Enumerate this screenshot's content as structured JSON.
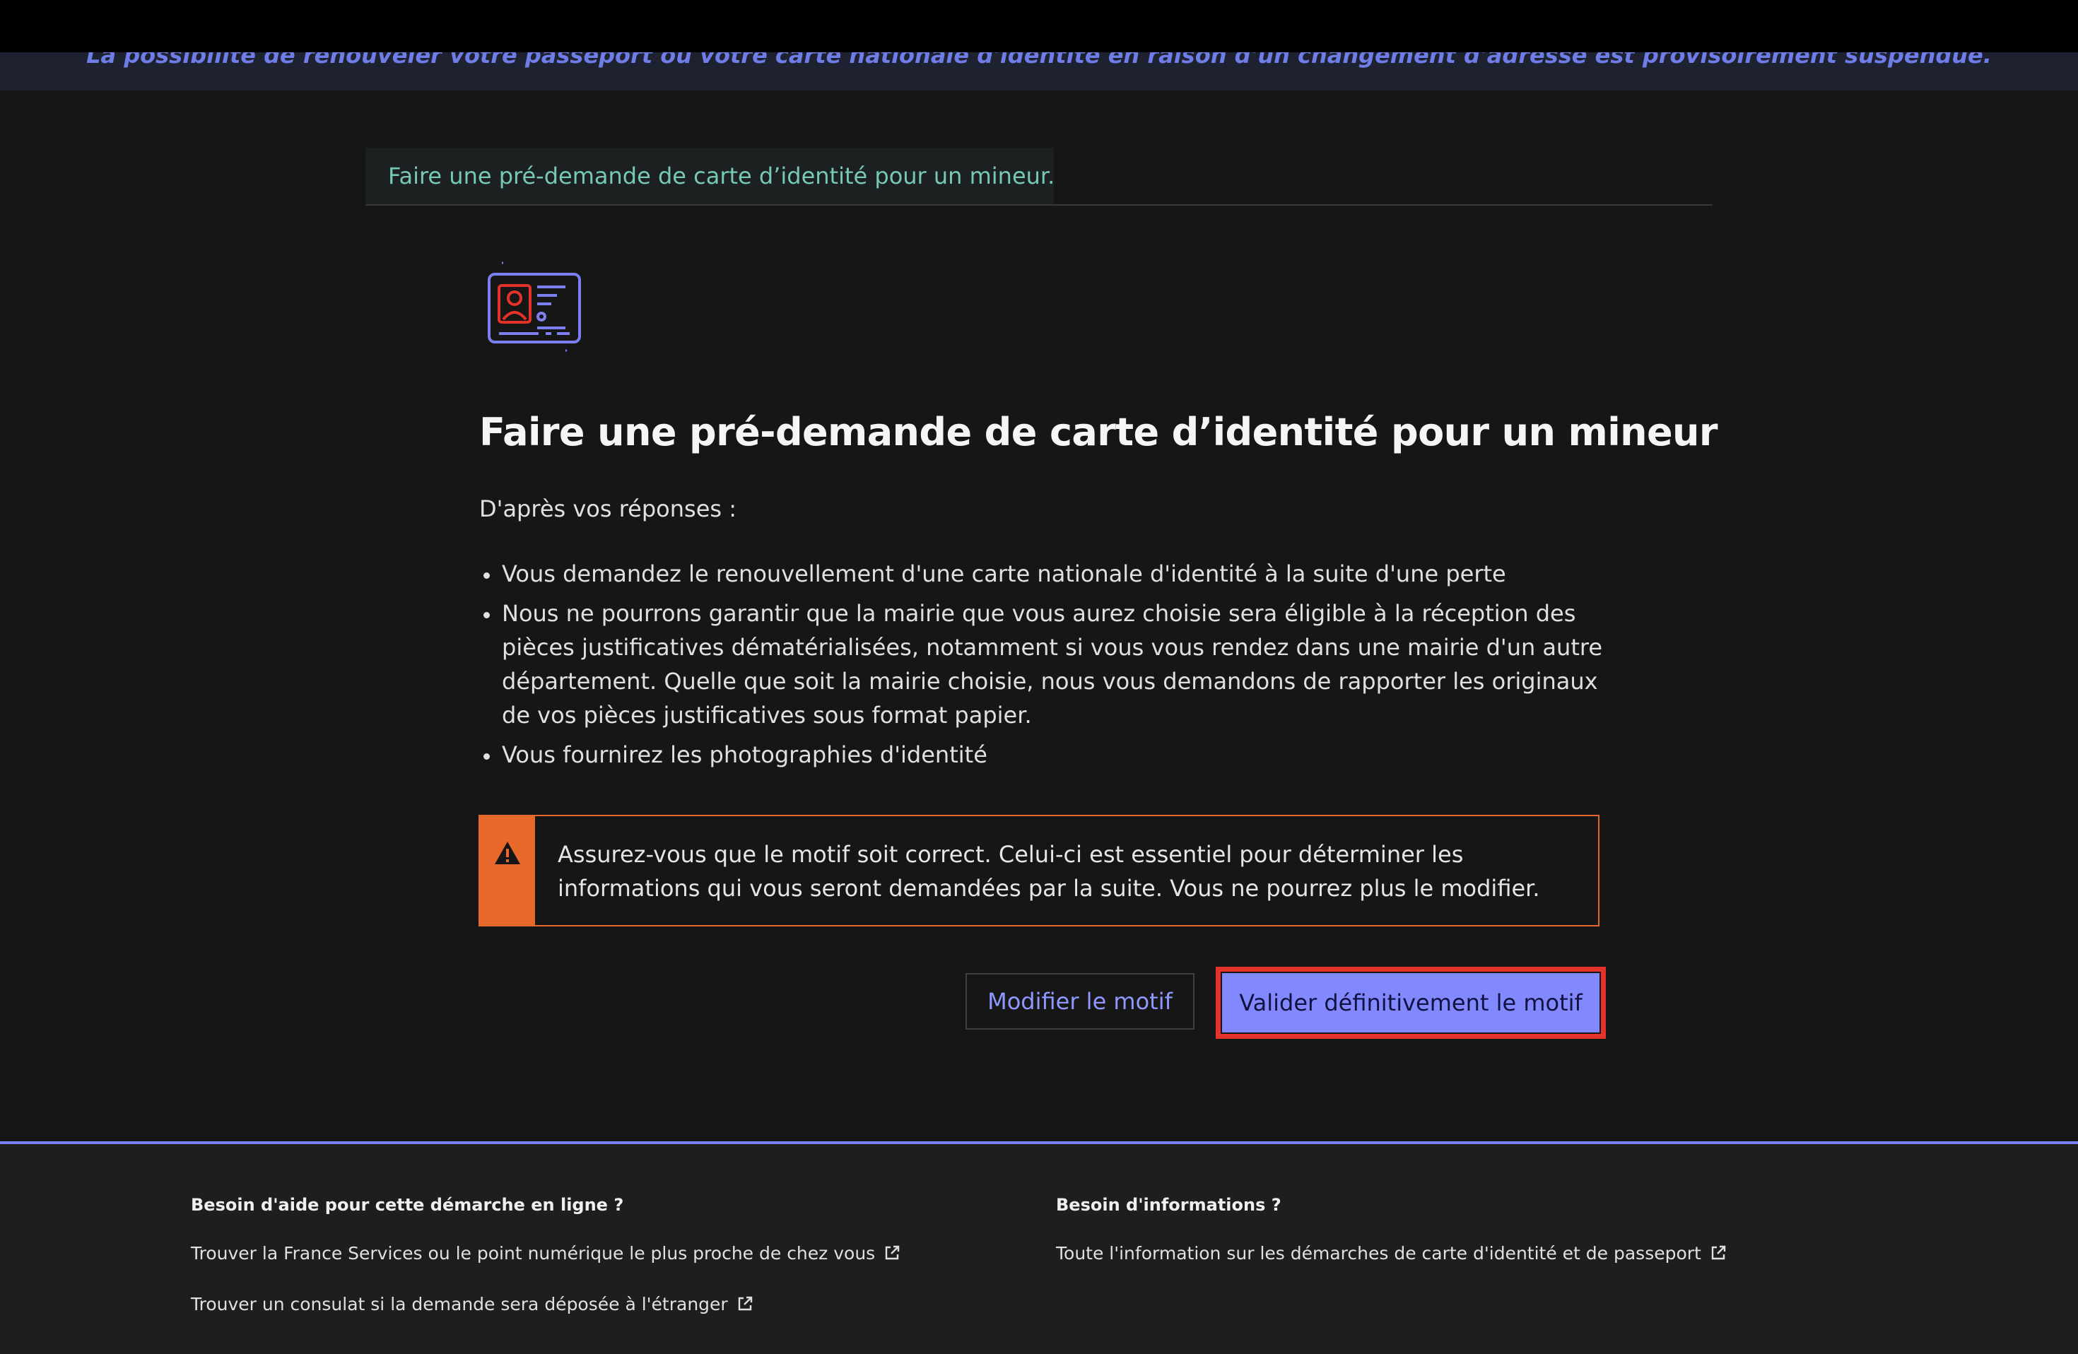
{
  "notice": {
    "text": "La possibilité de renouveler votre passeport ou votre carte nationale d'identité en raison d'un changement d'adresse est provisoirement suspendue."
  },
  "breadcrumb": {
    "label": "Faire une pré-demande de carte d’identité pour un mineur."
  },
  "main": {
    "icon": "id-card-icon",
    "title": "Faire une pré-demande de carte d’identité pour un mineur",
    "intro": "D'après vos réponses :",
    "answers": [
      "Vous demandez le renouvellement d'une carte nationale d'identité à la suite d'une perte",
      "Nous ne pourrons garantir que la mairie que vous aurez choisie sera éligible à la réception des pièces justificatives dématérialisées, notamment si vous vous rendez dans une mairie d'un autre département. Quelle que soit la mairie choisie, nous vous demandons de rapporter les originaux de vos pièces justificatives sous format papier.",
      "Vous fournirez les photographies d'identité"
    ],
    "alert": {
      "icon": "warning-icon",
      "text": "Assurez-vous que le motif soit correct. Celui-ci est essentiel pour déterminer les informations qui vous seront demandées par la suite. Vous ne pourrez plus le modifier."
    },
    "buttons": {
      "modify": "Modifier le motif",
      "validate": "Valider définitivement le motif"
    }
  },
  "footer": {
    "help": {
      "heading": "Besoin d'aide pour cette démarche en ligne ?",
      "links": [
        "Trouver la France Services ou le point numérique le plus proche de chez vous",
        "Trouver un consulat si la demande sera déposée à l'étranger"
      ]
    },
    "info": {
      "heading": "Besoin d'informations ?",
      "links": [
        "Toute l'information sur les démarches de carte d'identité et de passeport"
      ]
    }
  },
  "colors": {
    "accent": "#8289ff",
    "warning": "#e8672b",
    "focus_outline": "#e4322b",
    "breadcrumb_text": "#76c8b8"
  }
}
